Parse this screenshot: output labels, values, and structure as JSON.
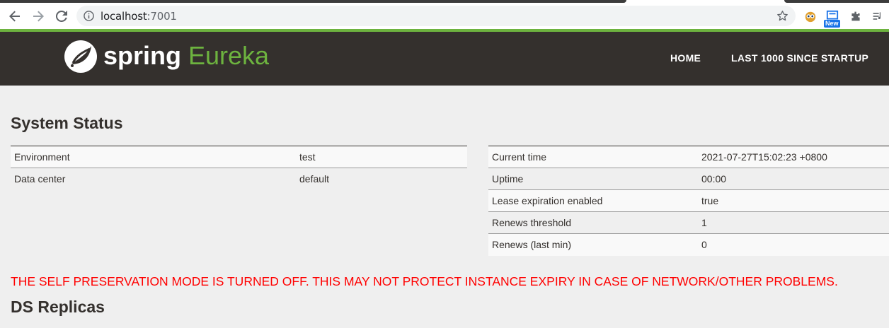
{
  "browser": {
    "url_host": "localhost",
    "url_port": ":7001",
    "extension_badge": "New"
  },
  "header": {
    "brand_spring": "spring",
    "brand_eureka": "Eureka",
    "nav": [
      {
        "label": "HOME"
      },
      {
        "label": "LAST 1000 SINCE STARTUP"
      }
    ]
  },
  "system_status": {
    "title": "System Status",
    "left_table": [
      {
        "key": "Environment",
        "value": "test"
      },
      {
        "key": "Data center",
        "value": "default"
      }
    ],
    "right_table": [
      {
        "key": "Current time",
        "value": "2021-07-27T15:02:23 +0800"
      },
      {
        "key": "Uptime",
        "value": "00:00"
      },
      {
        "key": "Lease expiration enabled",
        "value": "true"
      },
      {
        "key": "Renews threshold",
        "value": "1"
      },
      {
        "key": "Renews (last min)",
        "value": "0"
      }
    ]
  },
  "warning": "THE SELF PRESERVATION MODE IS TURNED OFF. THIS MAY NOT PROTECT INSTANCE EXPIRY IN CASE OF NETWORK/OTHER PROBLEMS.",
  "ds_replicas": {
    "title": "DS Replicas"
  },
  "colors": {
    "header_bg": "#34302d",
    "accent_green": "#6db33f",
    "warning_red": "#ff0000"
  }
}
